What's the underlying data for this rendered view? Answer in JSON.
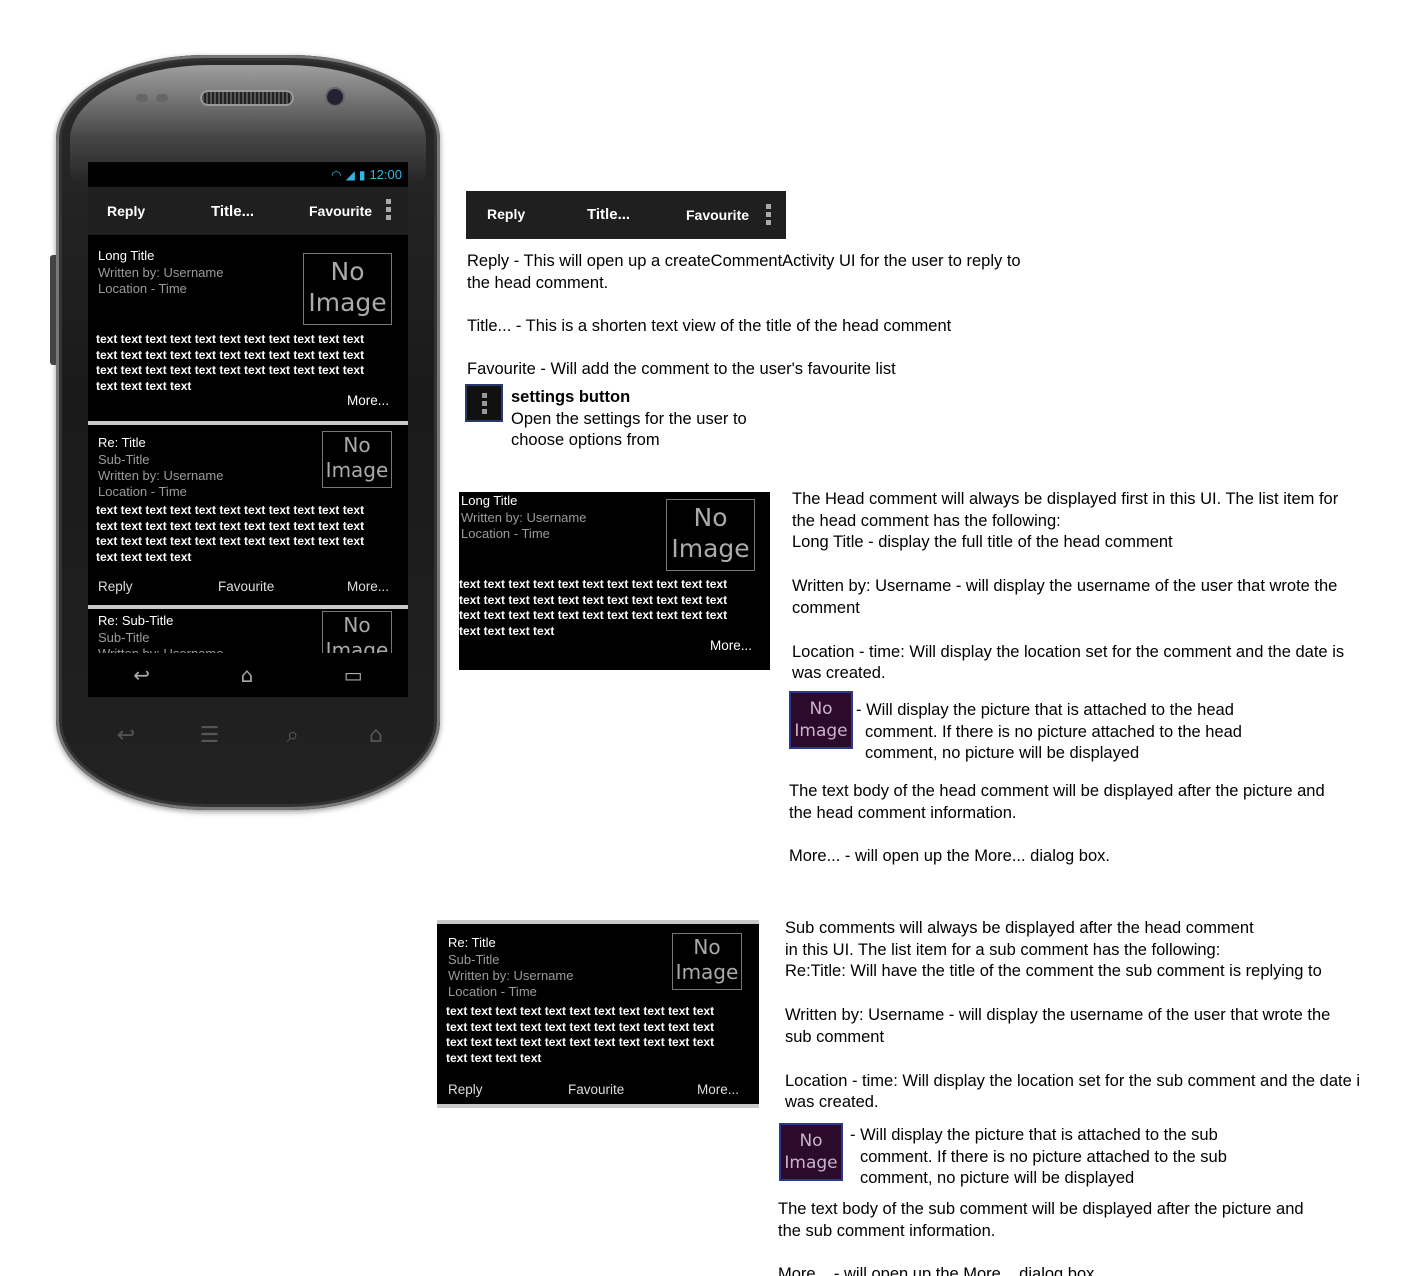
{
  "statusbar": {
    "time": "12:00"
  },
  "actionbar": {
    "reply": "Reply",
    "title": "Title...",
    "favourite": "Favourite"
  },
  "head_item": {
    "title": "Long Title",
    "written_by": "Written by: Username",
    "location": "Location - Time",
    "image_line1": "No",
    "image_line2": "Image",
    "body_lines": [
      "text text text text text text text text text text text",
      "text text text text text text text text text text text",
      "text text text text text text text text text text text",
      "text text text text"
    ],
    "more": "More..."
  },
  "sub_item": {
    "title": "Re: Title",
    "subtitle": "Sub-Title",
    "written_by": "Written by: Username",
    "location": "Location - Time",
    "image_line1": "No",
    "image_line2": "Image",
    "body_lines": [
      "text text text text text text text text text text text",
      "text text text text text text text text text text text",
      "text text text text text text text text text text text",
      "text text text text"
    ],
    "reply": "Reply",
    "favourite": "Favourite",
    "more": "More..."
  },
  "sub_item_2": {
    "title": "Re: Sub-Title",
    "subtitle": "Sub-Title",
    "written_by": "Written by: Username",
    "image_line1": "No",
    "image_line2": "Image"
  },
  "notes": {
    "reply_1": "Reply - This will open up a createCommentActivity UI for the user to reply to",
    "reply_2": "the head comment.",
    "title": "Title... - This is a shorten text view of the title of the head comment",
    "favourite": "Favourite - Will add the comment to the user's favourite list",
    "settings_heading": "settings button",
    "settings_1": "Open the settings for the user to",
    "settings_2": "choose options from",
    "head_1": "The Head comment will always be displayed first in this UI. The list item for",
    "head_2": "the head comment has the following:",
    "head_3": "Long Title - display the full title of the head comment",
    "head_4": "Written by: Username - will display the username of the user that wrote the",
    "head_5": "comment",
    "head_6": "Location - time: Will display the location set for the comment and the date is",
    "head_7": "was created.",
    "head_img_1": "- Will display the picture that is attached to the head",
    "head_img_2": "comment. If there is no picture attached to the head",
    "head_img_3": "comment, no picture will be displayed",
    "head_body_1": "The text body of the head comment will be displayed after the picture and",
    "head_body_2": "the head comment information.",
    "head_more": "More... - will open up the More... dialog box.",
    "sub_1": "Sub comments will always be displayed after the head comment",
    "sub_2": "in this UI. The list item for a sub comment has the following:",
    "sub_3": "Re:Title: Will have the title of the comment the sub comment is replying to",
    "sub_4": "Written by: Username - will display the username of the user that wrote the",
    "sub_5": "sub comment",
    "sub_6": "Location - time: Will display the location set for the sub comment and the date i",
    "sub_7": "was created.",
    "sub_img_1": "- Will display the picture that is attached to the sub",
    "sub_img_2": "comment. If there is no picture attached to the sub",
    "sub_img_3": "comment, no picture will be displayed",
    "sub_body_1": "The text body of the sub comment will be displayed after the picture and",
    "sub_body_2": "the sub comment information.",
    "sub_more": "More... - will open up the More... dialog box."
  },
  "icons": {
    "wifi": "wifi-icon",
    "signal": "signal-icon",
    "battery": "battery-icon",
    "overflow": "overflow-menu-icon",
    "back": "back-icon",
    "home": "home-icon",
    "recents": "recents-icon",
    "menu": "menu-icon",
    "search": "search-icon"
  },
  "colors": {
    "holo_blue": "#33b5e5",
    "action_bar": "#1f1f1f",
    "image_placeholder": "#2c0a2c"
  }
}
